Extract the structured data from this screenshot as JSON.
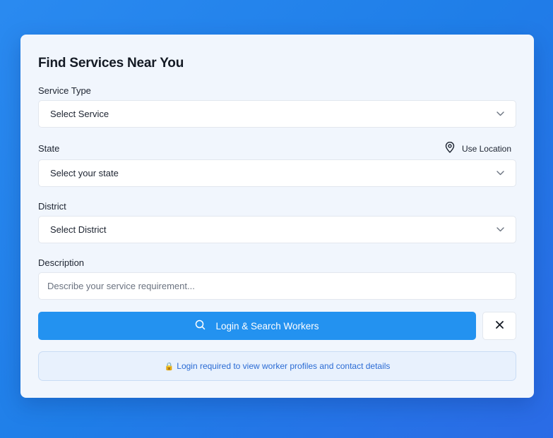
{
  "card": {
    "title": "Find Services Near You"
  },
  "service_type": {
    "label": "Service Type",
    "value": "Select Service"
  },
  "state": {
    "label": "State",
    "value": "Select your state",
    "use_location_label": "Use Location"
  },
  "district": {
    "label": "District",
    "value": "Select District"
  },
  "description": {
    "label": "Description",
    "placeholder": "Describe your service requirement..."
  },
  "actions": {
    "search_label": "Login & Search Workers"
  },
  "notice": {
    "icon": "🔒",
    "text": "Login required to view worker profiles and contact details"
  },
  "colors": {
    "background": "#2a8af0",
    "card": "#f1f6fd",
    "primary_button": "#2392f0",
    "notice_text": "#2a6bd4"
  },
  "icons": [
    "chevron-down-icon",
    "map-pin-icon",
    "search-icon",
    "close-icon",
    "lock-icon"
  ]
}
